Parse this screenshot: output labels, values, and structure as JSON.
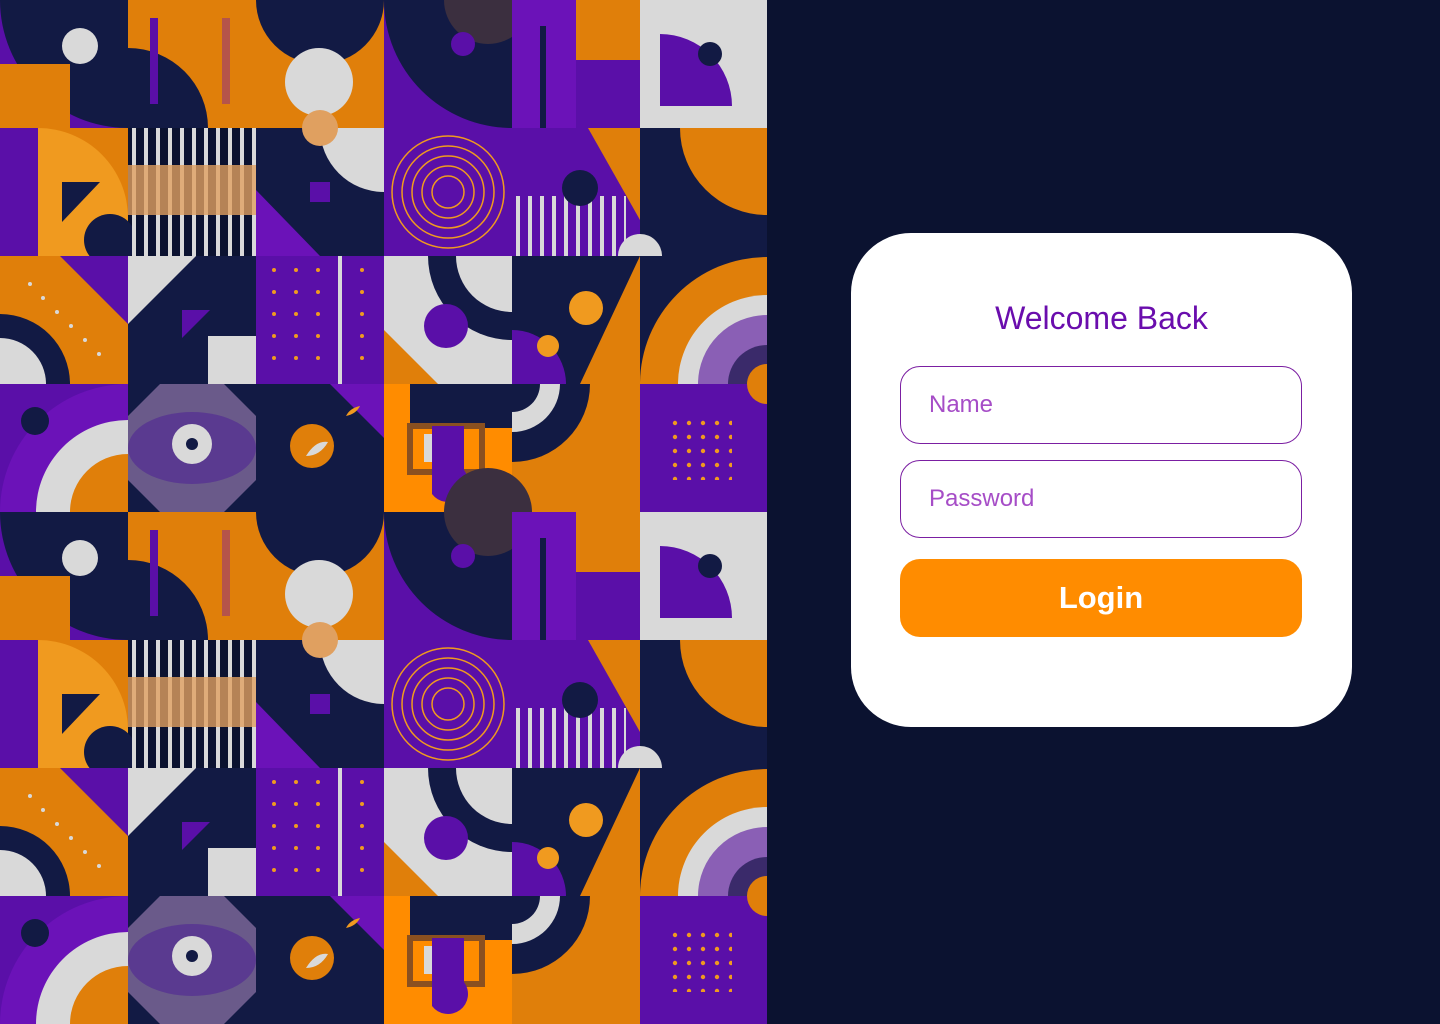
{
  "login_card": {
    "title": "Welcome Back",
    "name_placeholder": "Name",
    "password_placeholder": "Password",
    "login_label": "Login"
  },
  "palette": {
    "navy": "#0b1230",
    "dark_navy": "#121a44",
    "purple": "#5a0fa8",
    "violet": "#6b12b8",
    "orange": "#e07f0a",
    "light_orange": "#f09a1f",
    "gray": "#d9d9d9",
    "accent_orange": "#ff8c00",
    "title_purple": "#6a0dad"
  }
}
